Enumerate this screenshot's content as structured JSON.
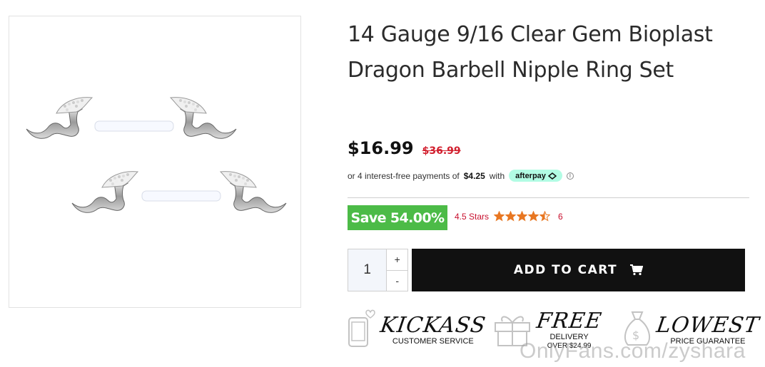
{
  "product": {
    "title": "14 Gauge 9/16 Clear Gem Bioplast Dragon Barbell Nipple Ring Set",
    "image_alt": "Dragon barbell nipple ring set with clear gem wings"
  },
  "pricing": {
    "price": "$16.99",
    "old_price": "$36.99",
    "installments_prefix": "or 4 interest-free payments of",
    "installment_amount": "$4.25",
    "installments_with": "with",
    "afterpay_label": "afterpay",
    "info_icon": "ⓘ"
  },
  "savings": {
    "badge": "Save 54.00%",
    "rating_label": "4.5 Stars",
    "rating_value": 4.5,
    "rating_max": 5,
    "review_count": "6"
  },
  "cart": {
    "quantity": "1",
    "increment_label": "+",
    "decrement_label": "-",
    "add_to_cart_label": "ADD TO CART"
  },
  "perks": [
    {
      "headline": "KICKASS",
      "sub": "CUSTOMER SERVICE",
      "icon": "phone-heart-icon"
    },
    {
      "headline": "FREE",
      "sub": "DELIVERY",
      "sub2": "OVER $24.99",
      "icon": "gift-box-icon"
    },
    {
      "headline": "LOWEST",
      "sub": "PRICE GUARANTEE",
      "icon": "money-bag-icon"
    }
  ],
  "watermark": "OnlyFans.com/zyshara",
  "colors": {
    "save_green": "#4cbb47",
    "sale_red": "#d2202f",
    "star_orange": "#e87722",
    "cart_black": "#111111",
    "afterpay_mint": "#b2fce4"
  }
}
